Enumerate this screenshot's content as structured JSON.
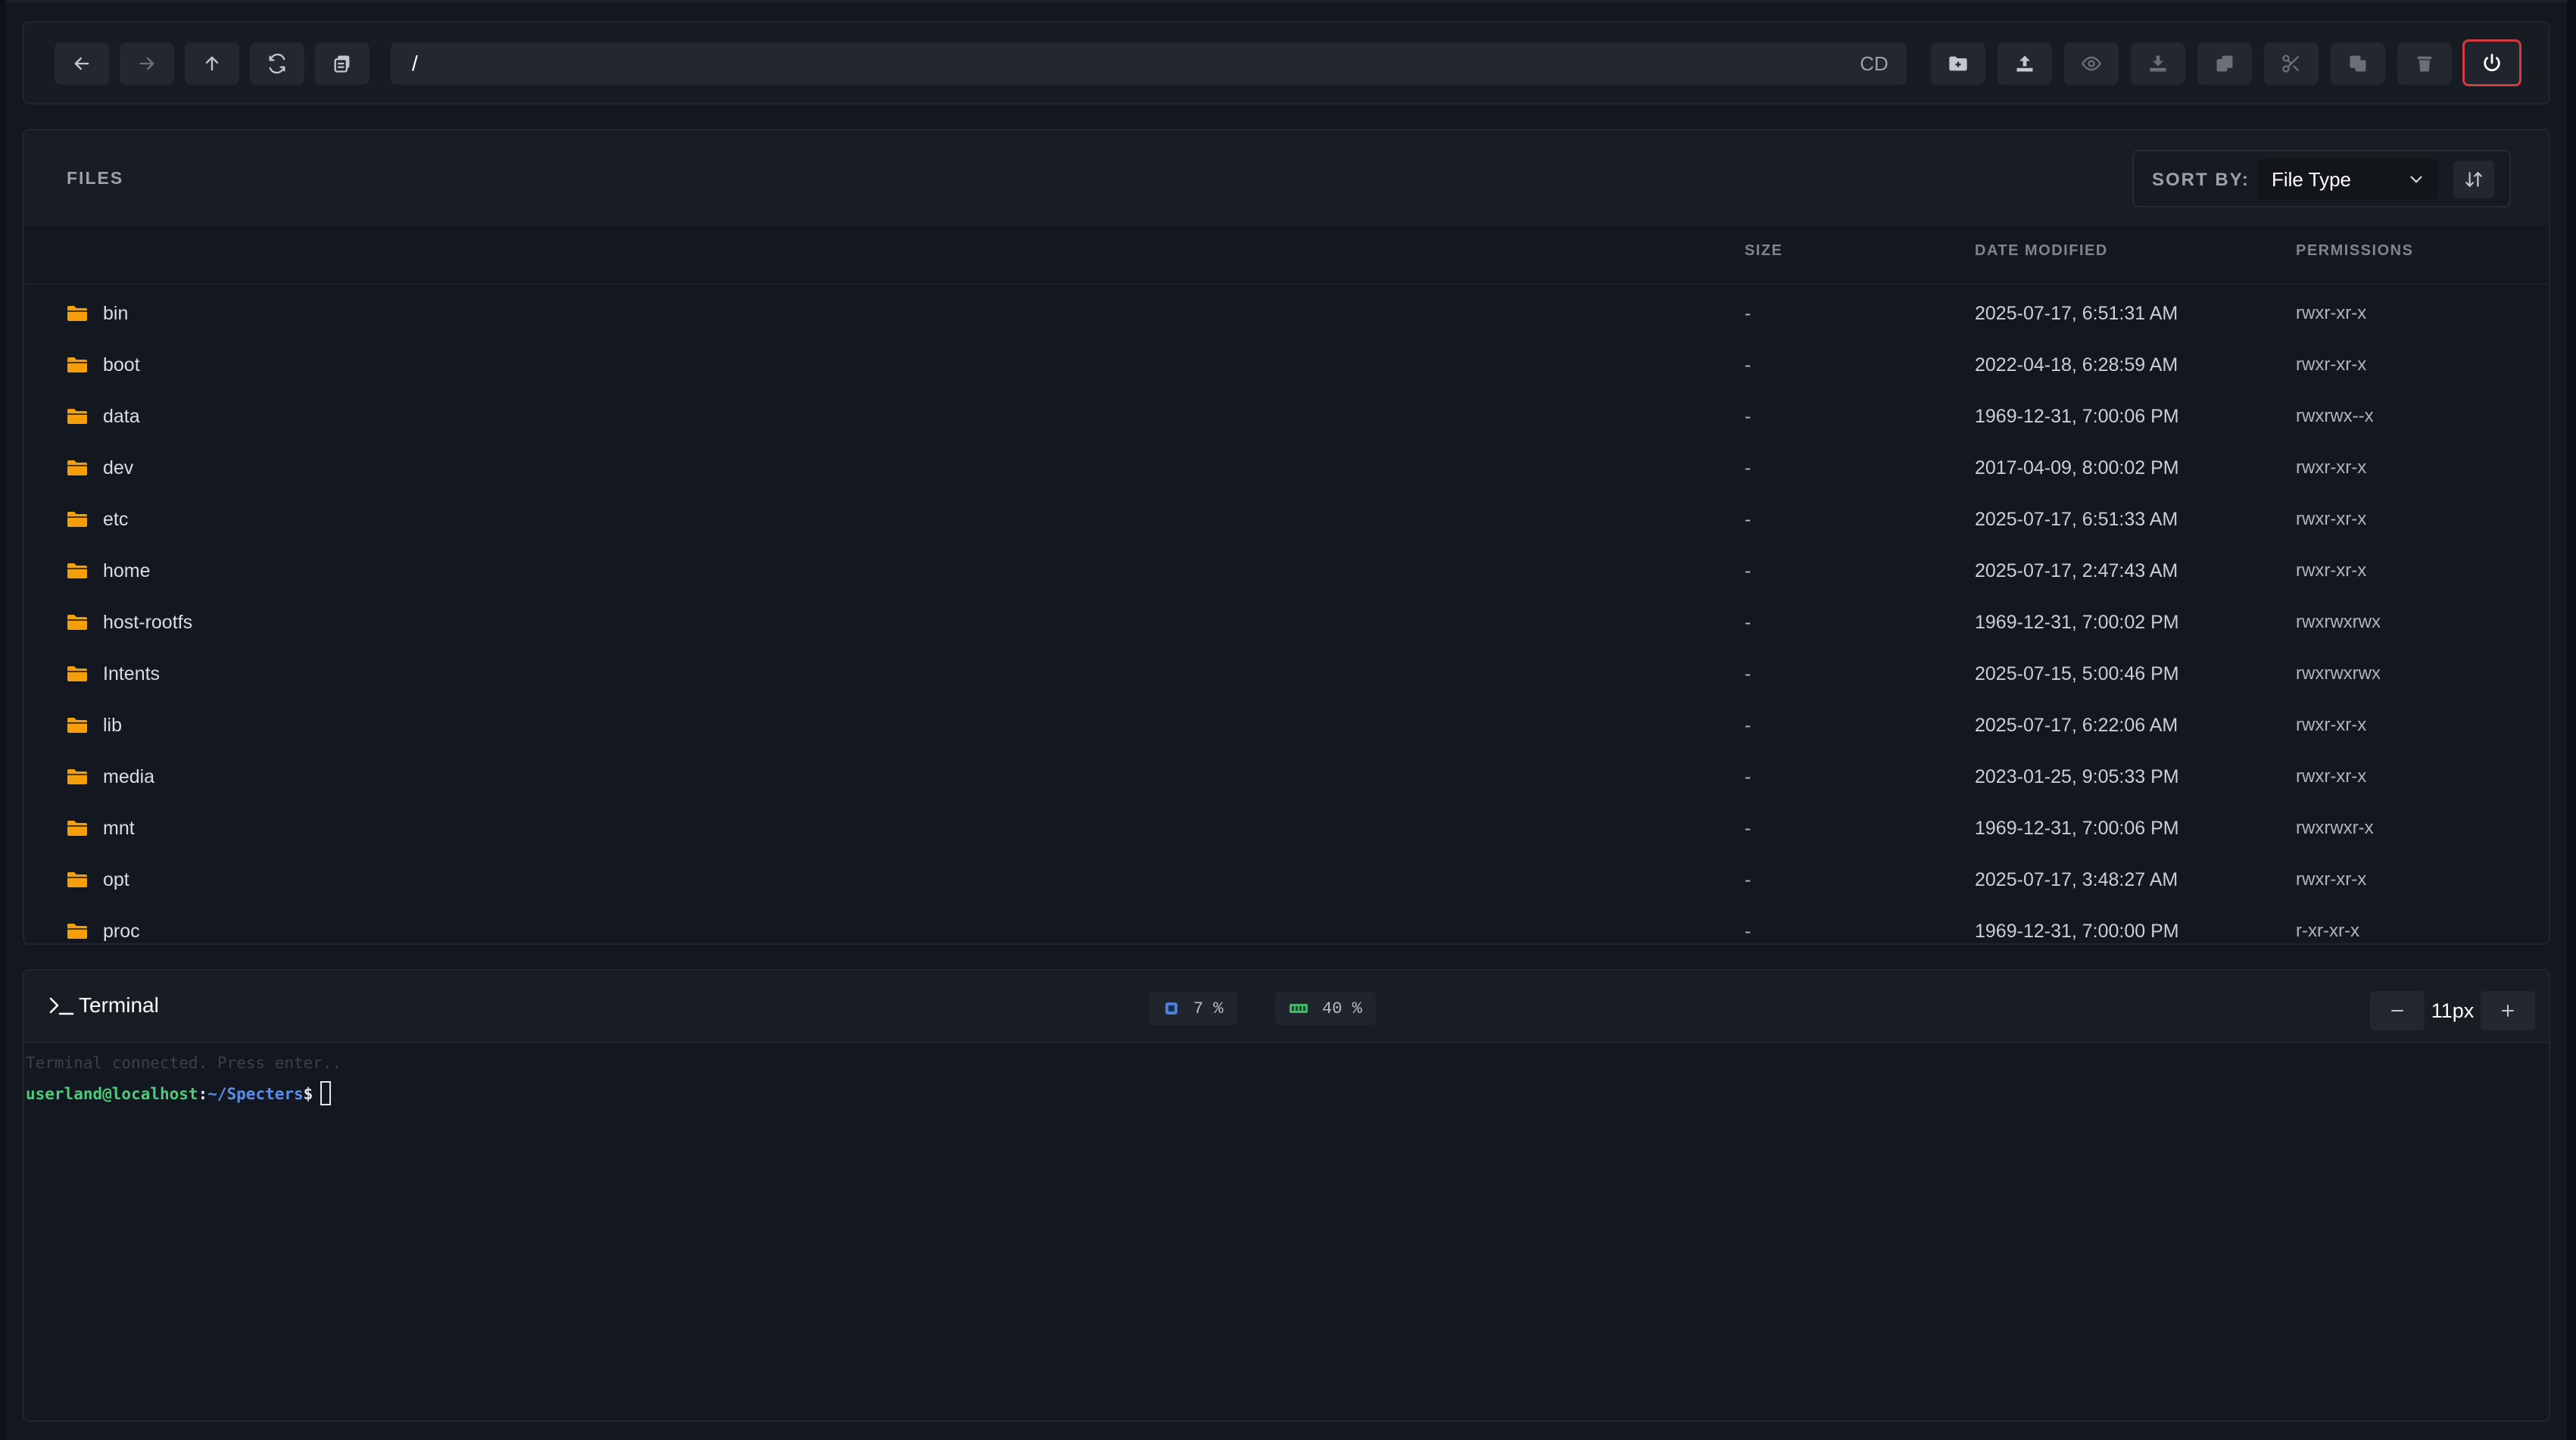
{
  "toolbar": {
    "path": "/",
    "cd_label": "CD",
    "icons": [
      "arrow-left-icon",
      "arrow-right-icon",
      "arrow-up-icon",
      "refresh-icon",
      "copy-path-icon",
      "new-folder-icon",
      "upload-icon",
      "view-icon",
      "download-icon",
      "paste-icon",
      "cut-icon",
      "duplicate-icon",
      "trash-icon",
      "power-icon"
    ]
  },
  "files": {
    "title": "FILES",
    "sort_label": "SORT BY:",
    "sort_value": "File Type",
    "columns": {
      "size": "SIZE",
      "date": "DATE MODIFIED",
      "permissions": "PERMISSIONS"
    },
    "folder_color": "#f59e0b",
    "rows": [
      {
        "name": "bin",
        "size": "-",
        "date": "2025-07-17, 6:51:31 AM",
        "perm": "rwxr-xr-x"
      },
      {
        "name": "boot",
        "size": "-",
        "date": "2022-04-18, 6:28:59 AM",
        "perm": "rwxr-xr-x"
      },
      {
        "name": "data",
        "size": "-",
        "date": "1969-12-31, 7:00:06 PM",
        "perm": "rwxrwx--x"
      },
      {
        "name": "dev",
        "size": "-",
        "date": "2017-04-09, 8:00:02 PM",
        "perm": "rwxr-xr-x"
      },
      {
        "name": "etc",
        "size": "-",
        "date": "2025-07-17, 6:51:33 AM",
        "perm": "rwxr-xr-x"
      },
      {
        "name": "home",
        "size": "-",
        "date": "2025-07-17, 2:47:43 AM",
        "perm": "rwxr-xr-x"
      },
      {
        "name": "host-rootfs",
        "size": "-",
        "date": "1969-12-31, 7:00:02 PM",
        "perm": "rwxrwxrwx"
      },
      {
        "name": "Intents",
        "size": "-",
        "date": "2025-07-15, 5:00:46 PM",
        "perm": "rwxrwxrwx"
      },
      {
        "name": "lib",
        "size": "-",
        "date": "2025-07-17, 6:22:06 AM",
        "perm": "rwxr-xr-x"
      },
      {
        "name": "media",
        "size": "-",
        "date": "2023-01-25, 9:05:33 PM",
        "perm": "rwxr-xr-x"
      },
      {
        "name": "mnt",
        "size": "-",
        "date": "1969-12-31, 7:00:06 PM",
        "perm": "rwxrwxr-x"
      },
      {
        "name": "opt",
        "size": "-",
        "date": "2025-07-17, 3:48:27 AM",
        "perm": "rwxr-xr-x"
      },
      {
        "name": "proc",
        "size": "-",
        "date": "1969-12-31, 7:00:00 PM",
        "perm": "r-xr-xr-x"
      }
    ]
  },
  "terminal": {
    "title": "Terminal",
    "cpu": "7 %",
    "memory": "40 %",
    "font_size": "11px",
    "status_line": "Terminal connected. Press enter..",
    "prompt_user": "userland@localhost",
    "prompt_colon": ":",
    "prompt_path": "~/Specters",
    "prompt_dollar": "$"
  },
  "colors": {
    "accent_danger": "#d23a44",
    "cpu_icon": "#4a7fd6",
    "mem_icon": "#3fb86a",
    "prompt_user": "#4fc97a",
    "prompt_path": "#5b8ee8"
  }
}
